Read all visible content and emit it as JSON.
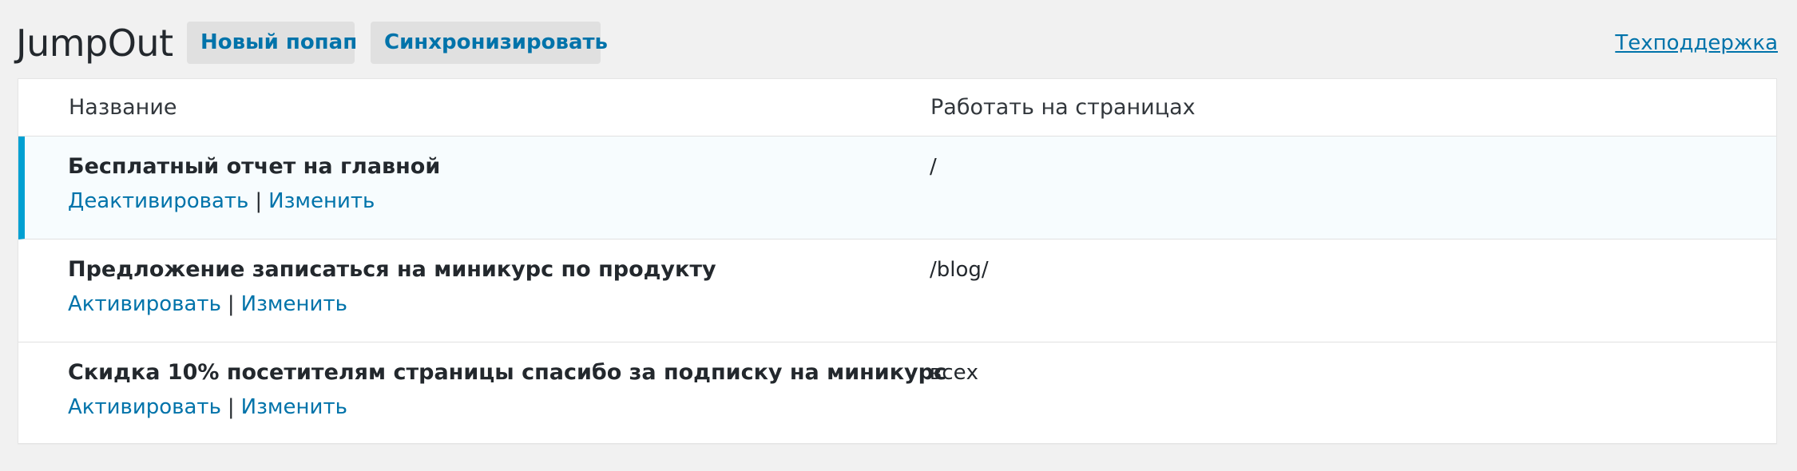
{
  "header": {
    "title": "JumpOut",
    "new_popup_label": "Новый попап",
    "sync_label": "Синхронизировать",
    "support_label": "Техподдержка"
  },
  "table": {
    "columns": [
      "Название",
      "Работать на страницах"
    ],
    "rows": [
      {
        "title": "Бесплатный отчет на главной",
        "toggle_label": "Деактивировать",
        "edit_label": "Изменить",
        "separator": "|",
        "pages": "/",
        "active": true
      },
      {
        "title": "Предложение записаться на миникурс по продукту",
        "toggle_label": "Активировать",
        "edit_label": "Изменить",
        "separator": "|",
        "pages": "/blog/",
        "active": false
      },
      {
        "title": "Скидка 10% посетителям страницы спасибо за подписку на миникурс",
        "toggle_label": "Активировать",
        "edit_label": "Изменить",
        "separator": "|",
        "pages": "всех",
        "active": false
      }
    ]
  },
  "colors": {
    "link": "#0073aa",
    "active_row_border": "#00a0d2",
    "active_row_bg": "#f7fcfe",
    "page_bg": "#f1f1f1",
    "button_bg": "#e0e0e0"
  }
}
